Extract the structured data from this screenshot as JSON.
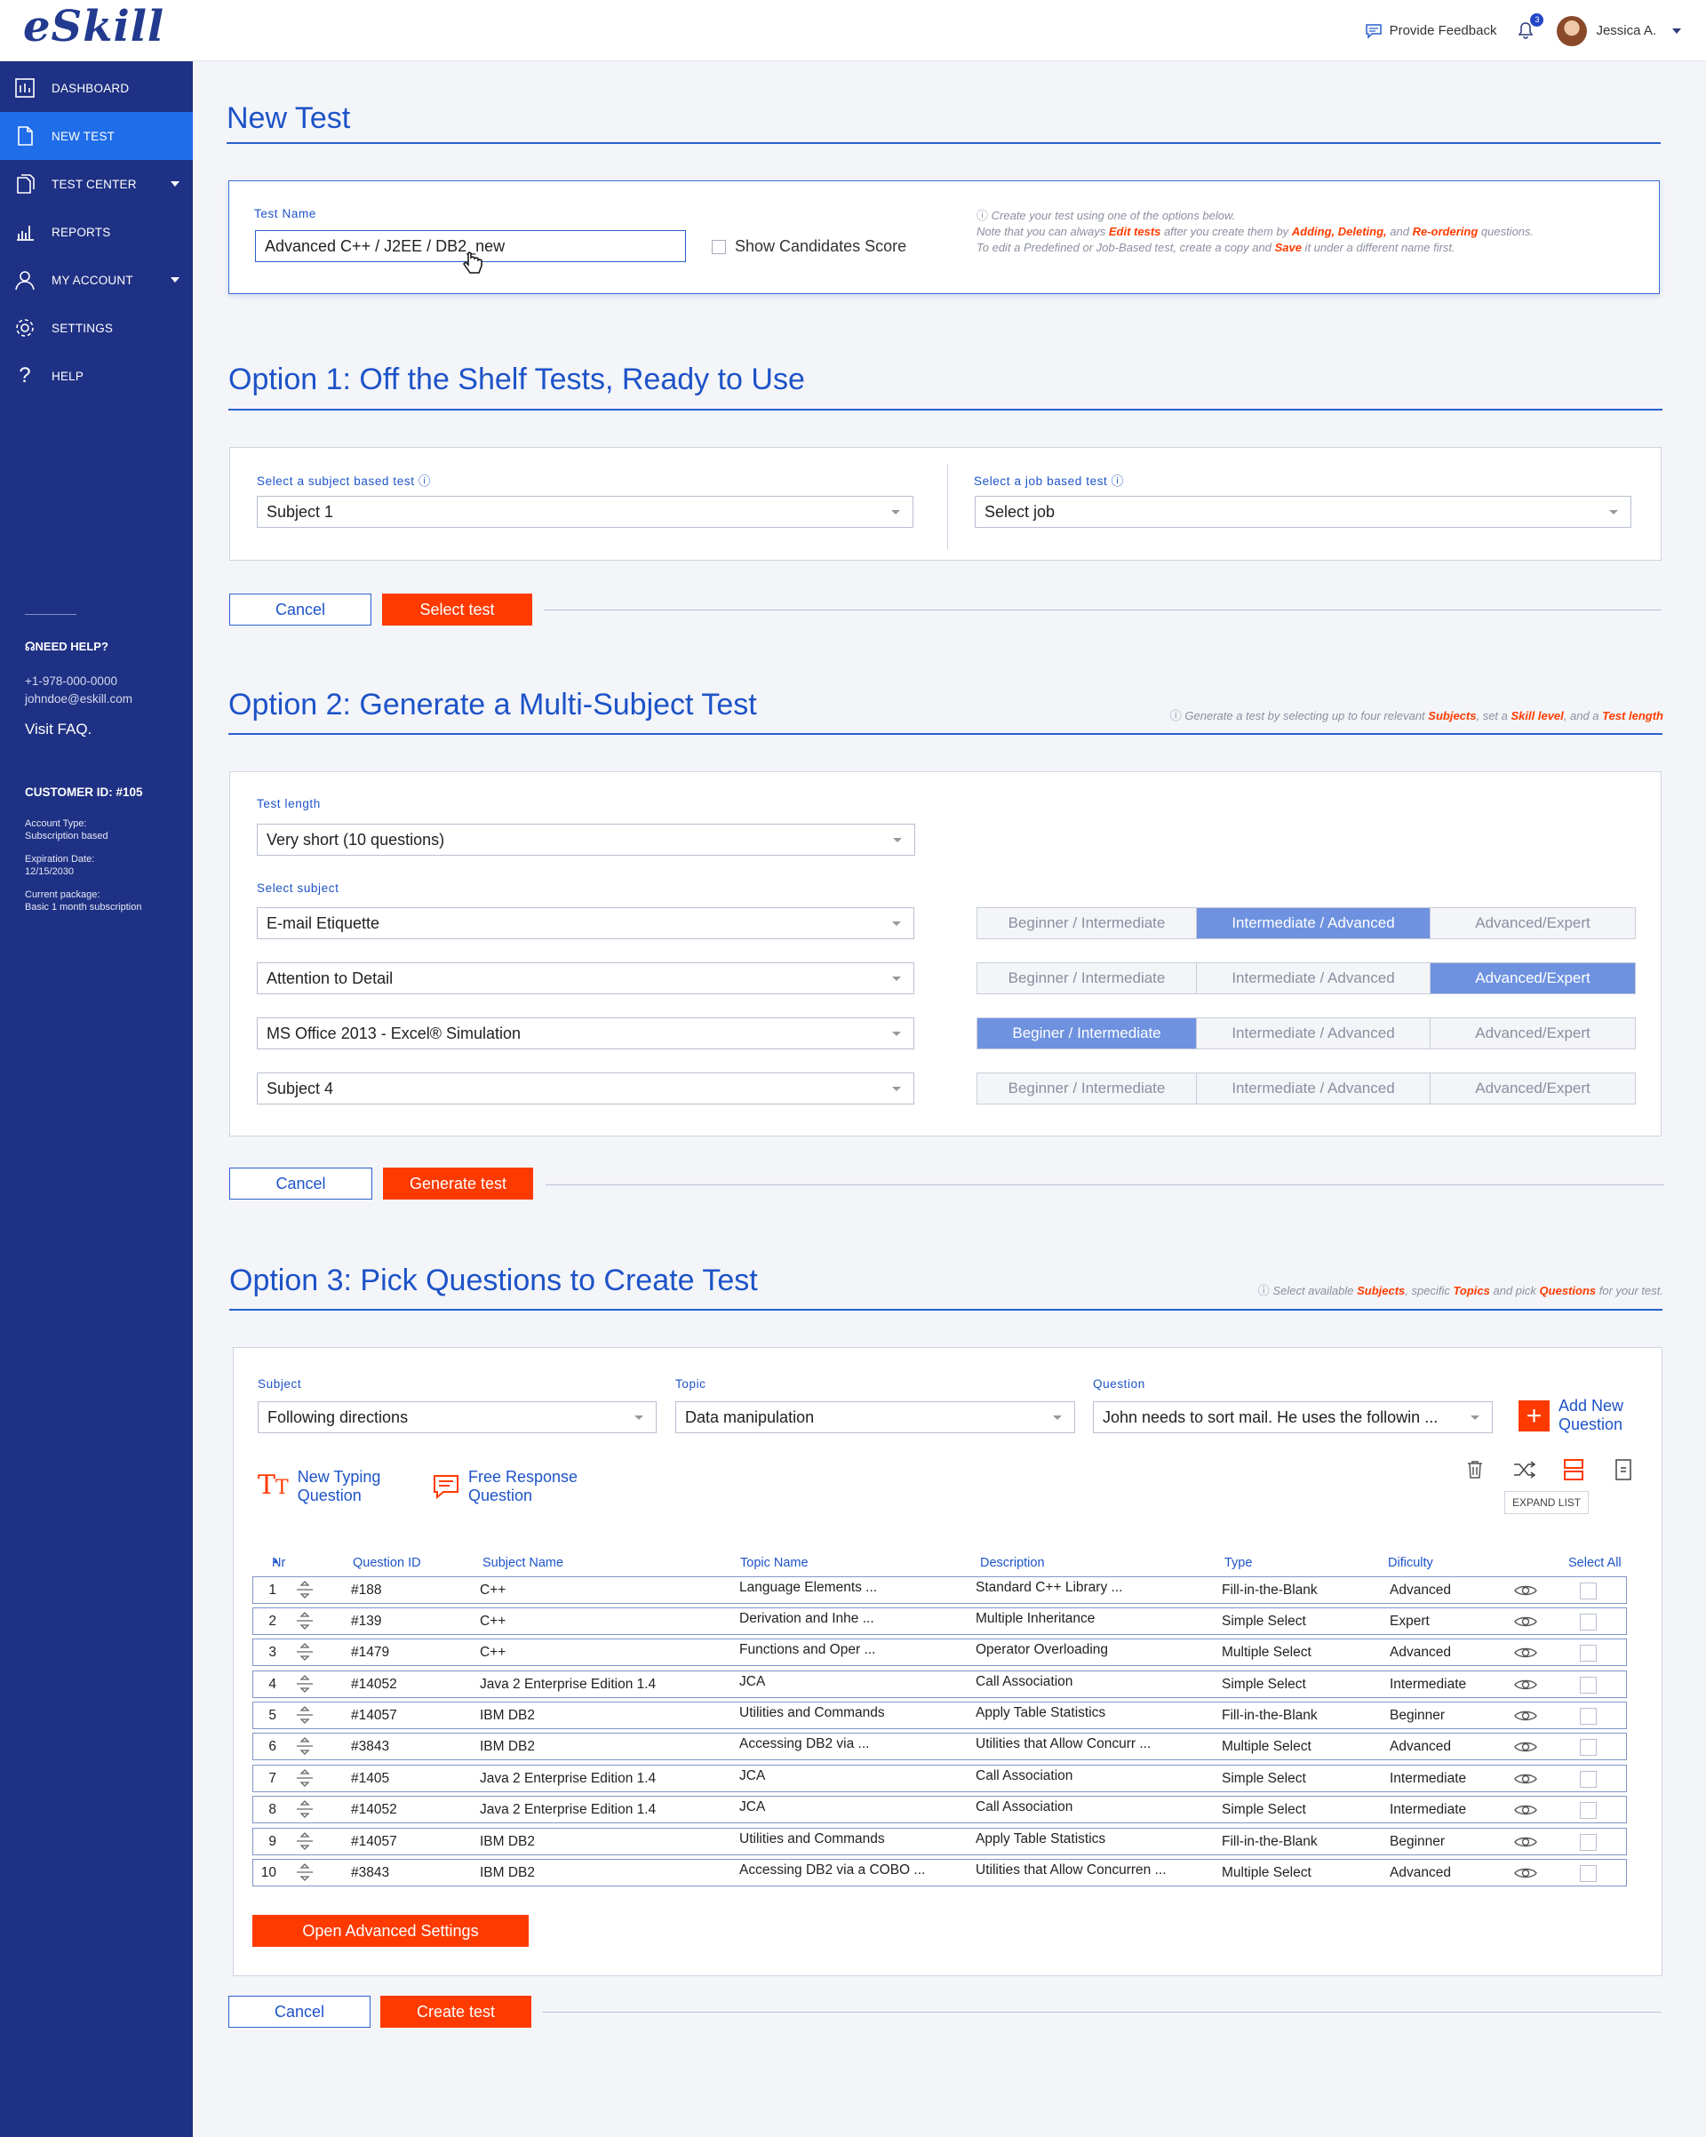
{
  "brand": {
    "logo": "eSkill",
    "accent": "#1d53c8",
    "red": "#ff3a00",
    "sidebar": "#1f3184"
  },
  "topbar": {
    "feedback": "Provide Feedback",
    "notifications": "3",
    "user": "Jessica A."
  },
  "sidebar": {
    "items": [
      {
        "label": "DASHBOARD",
        "icon": "dashboard-icon"
      },
      {
        "label": "NEW TEST",
        "icon": "new-test-icon"
      },
      {
        "label": "TEST CENTER",
        "icon": "test-center-icon"
      },
      {
        "label": "REPORTS",
        "icon": "reports-icon"
      },
      {
        "label": "MY ACCOUNT",
        "icon": "user-icon"
      },
      {
        "label": "SETTINGS",
        "icon": "gear-icon"
      },
      {
        "label": "HELP",
        "icon": "help-icon"
      }
    ],
    "need_help": "NEED HELP?",
    "phone": "+1-978-000-0000",
    "email": "johndoe@eskill.com",
    "faq": "Visit FAQ.",
    "customer_id": "CUSTOMER ID: #105",
    "account_type_label": "Account Type:",
    "account_type": "Subscription based",
    "expiration_label": "Expiration Date:",
    "expiration": "12/15/2030",
    "package_label": "Current package:",
    "package": "Basic 1 month subscription"
  },
  "page": {
    "title": "New Test"
  },
  "testname": {
    "label": "Test Name",
    "value": "Advanced C++ / J2EE / DB2_new",
    "show_score": "Show Candidates Score",
    "note1": "Create your test using one of the options below.",
    "note2a": "Note that you can always ",
    "note2b": "Edit tests",
    "note2c": " after you create them by ",
    "note2d": "Adding, Deleting,",
    "note2e": " and ",
    "note2f": "Re-ordering",
    "note2g": " questions.",
    "note3a": "To edit a Predefined or Job-Based test, create a copy and ",
    "note3b": "Save",
    "note3c": " it under a different name first."
  },
  "opt1": {
    "title": "Option 1: Off the Shelf Tests, Ready to Use",
    "subject_label": "Select a subject based test",
    "subject_value": "Subject 1",
    "job_label": "Select a job based test",
    "job_value": "Select job",
    "cancel": "Cancel",
    "select": "Select test"
  },
  "opt2": {
    "title": "Option 2: Generate a Multi-Subject Test",
    "note_a": "Generate a test by selecting up to four relevant ",
    "note_b": "Subjects",
    "note_c": ", set a ",
    "note_d": "Skill level",
    "note_e": ", and a ",
    "note_f": "Test length",
    "length_label": "Test length",
    "length_value": "Very short (10 questions)",
    "subject_label": "Select subject",
    "rows": [
      {
        "subject": "E-mail Etiquette",
        "levels": [
          "Beginner / Intermediate",
          "Intermediate / Advanced",
          "Advanced/Expert"
        ],
        "selected": 1
      },
      {
        "subject": "Attention to Detail",
        "levels": [
          "Beginner / Intermediate",
          "Intermediate / Advanced",
          "Advanced/Expert"
        ],
        "selected": 2
      },
      {
        "subject": "MS Office 2013 - Excel® Simulation",
        "levels": [
          "Beginer / Intermediate",
          "Intermediate / Advanced",
          "Advanced/Expert"
        ],
        "selected": 0
      },
      {
        "subject": "Subject 4",
        "levels": [
          "Beginner / Intermediate",
          "Intermediate / Advanced",
          "Advanced/Expert"
        ],
        "selected": -1
      }
    ],
    "cancel": "Cancel",
    "generate": "Generate test"
  },
  "opt3": {
    "title": "Option 3: Pick Questions to Create Test",
    "note_a": "Select available ",
    "note_b": "Subjects",
    "note_c": ", specific ",
    "note_d": "Topics",
    "note_e": " and pick ",
    "note_f": "Questions",
    "note_g": " for your test.",
    "subject_label": "Subject",
    "subject_value": "Following directions",
    "topic_label": "Topic",
    "topic_value": "Data manipulation",
    "question_label": "Question",
    "question_value": "John needs to sort mail. He uses the followin ...",
    "add_new_1": "Add New",
    "add_new_2": "Question",
    "typing_1": "New Typing",
    "typing_2": "Question",
    "free_1": "Free Response",
    "free_2": "Question",
    "expand": "EXPAND LIST",
    "headers": {
      "nr": "Nr",
      "qid": "Question ID",
      "subject": "Subject Name",
      "topic": "Topic Name",
      "desc": "Description",
      "type": "Type",
      "diff": "Dificulty",
      "all": "Select All"
    },
    "rows": [
      {
        "nr": "1",
        "qid": "#188",
        "subject": "C++",
        "topic": "Language Elements ...",
        "desc": "Standard C++ Library ...",
        "type": "Fill-in-the-Blank",
        "diff": "Advanced"
      },
      {
        "nr": "2",
        "qid": "#139",
        "subject": "C++",
        "topic": "Derivation and Inhe ...",
        "desc": "Multiple Inheritance",
        "type": "Simple Select",
        "diff": "Expert"
      },
      {
        "nr": "3",
        "qid": "#1479",
        "subject": "C++",
        "topic": "Functions and Oper ...",
        "desc": "Operator Overloading",
        "type": "Multiple Select",
        "diff": "Advanced"
      },
      {
        "nr": "4",
        "qid": "#14052",
        "subject": "Java 2 Enterprise Edition 1.4",
        "topic": "JCA",
        "desc": "Call Association",
        "type": "Simple Select",
        "diff": "Intermediate"
      },
      {
        "nr": "5",
        "qid": "#14057",
        "subject": "IBM DB2",
        "topic": "Utilities and Commands",
        "desc": "Apply Table Statistics",
        "type": "Fill-in-the-Blank",
        "diff": "Beginner"
      },
      {
        "nr": "6",
        "qid": "#3843",
        "subject": "IBM DB2",
        "topic": "Accessing DB2 via ...",
        "desc": "Utilities that Allow Concurr ...",
        "type": "Multiple Select",
        "diff": "Advanced"
      },
      {
        "nr": "7",
        "qid": "#1405",
        "subject": "Java 2 Enterprise Edition 1.4",
        "topic": "JCA",
        "desc": "Call Association",
        "type": "Simple Select",
        "diff": "Intermediate"
      },
      {
        "nr": "8",
        "qid": "#14052",
        "subject": "Java 2 Enterprise Edition 1.4",
        "topic": "JCA",
        "desc": "Call Association",
        "type": "Simple Select",
        "diff": "Intermediate"
      },
      {
        "nr": "9",
        "qid": "#14057",
        "subject": "IBM DB2",
        "topic": "Utilities and Commands",
        "desc": "Apply Table Statistics",
        "type": "Fill-in-the-Blank",
        "diff": "Beginner"
      },
      {
        "nr": "10",
        "qid": "#3843",
        "subject": "IBM DB2",
        "topic": "Accessing DB2 via a COBO ...",
        "desc": "Utilities that Allow Concurren ...",
        "type": "Multiple Select",
        "diff": "Advanced"
      }
    ],
    "advanced": "Open Advanced Settings",
    "cancel": "Cancel",
    "create": "Create test"
  }
}
